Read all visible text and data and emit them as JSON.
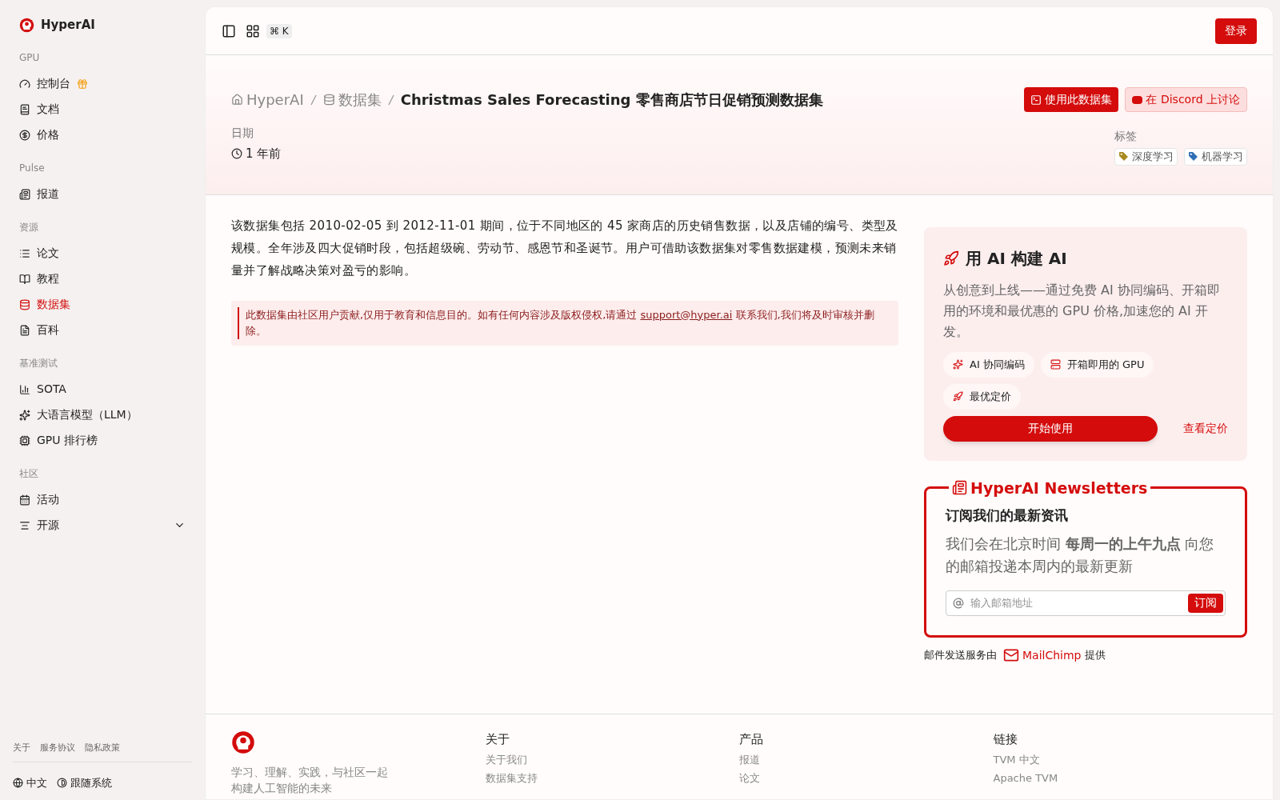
{
  "brand": "HyperAI",
  "sidebar": {
    "groups": [
      {
        "label": "GPU",
        "items": [
          {
            "label": "控制台",
            "selected": false
          },
          {
            "label": "文档",
            "selected": false
          },
          {
            "label": "价格",
            "selected": false
          }
        ]
      },
      {
        "label": "Pulse",
        "items": [
          {
            "label": "报道",
            "selected": false
          }
        ]
      },
      {
        "label": "资源",
        "items": [
          {
            "label": "论文",
            "selected": false
          },
          {
            "label": "教程",
            "selected": false
          },
          {
            "label": "数据集",
            "selected": true
          },
          {
            "label": "百科",
            "selected": false
          }
        ]
      },
      {
        "label": "基准测试",
        "items": [
          {
            "label": "SOTA",
            "selected": false
          },
          {
            "label": "大语言模型（LLM）",
            "selected": false
          },
          {
            "label": "GPU 排行榜",
            "selected": false
          }
        ]
      },
      {
        "label": "社区",
        "items": [
          {
            "label": "活动",
            "selected": false
          },
          {
            "label": "开源",
            "selected": false,
            "expanded": false
          }
        ]
      }
    ],
    "footer_links": [
      "关于",
      "服务协议",
      "隐私政策"
    ],
    "language": "中文",
    "theme": "跟随系统"
  },
  "topbar": {
    "shortcut": "⌘ K",
    "login": "登录"
  },
  "breadcrumb": [
    "HyperAI",
    "数据集"
  ],
  "title": "Christmas Sales Forecasting 零售商店节日促销预测数据集",
  "actions": [
    "使用此数据集",
    "在 Discord 上讨论"
  ],
  "date_label": "日期",
  "date": "1 年前",
  "tags_label": "标签",
  "tags": [
    {
      "label": "深度学习",
      "color": "#a8891f"
    },
    {
      "label": "机器学习",
      "color": "#2f6fb5"
    }
  ],
  "description": "该数据集包括 2010-02-05 到 2012-11-01 期间，位于不同地区的 45 家商店的历史销售数据，以及店铺的编号、类型及规模。全年涉及四大促销时段，包括超级碗、劳动节、感恩节和圣诞节。用户可借助该数据集对零售数据建模，预测未来销量并了解战略决策对盈亏的影响。",
  "notice": {
    "before": "此数据集由社区用户贡献,仅用于教育和信息目的。如有任何内容涉及版权侵权,请通过",
    "link": "support@hyper.ai",
    "after": "联系我们,我们将及时审核并删除。"
  },
  "promo": {
    "title": "用 AI 构建 AI",
    "text": "从创意到上线——通过免费 AI 协同编码、开箱即用的环境和最优惠的 GPU 价格,加速您的 AI 开发。",
    "features": [
      {
        "label": "AI 协同编码"
      },
      {
        "label": "开箱即用的 GPU"
      },
      {
        "label": "最优定价"
      }
    ],
    "start": "开始使用",
    "pricing": "查看定价"
  },
  "newsletter": {
    "title": "HyperAI Newsletters",
    "heading": "订阅我们的最新资讯",
    "text": "我们会在北京时间 **每周一的上午九点** 向您的邮箱投递本周内的最新更新",
    "placeholder": "输入邮箱地址",
    "button": "订阅",
    "credit_before": "邮件发送服务由",
    "credit_brand": "MailChimp",
    "credit_after": "提供"
  },
  "footer": {
    "slogan": "学习、理解、实践，与社区一起构建人工智能的未来",
    "columns": [
      {
        "title": "关于",
        "links": [
          "关于我们",
          "数据集支持"
        ]
      },
      {
        "title": "产品",
        "links": [
          "报道",
          "论文"
        ]
      },
      {
        "title": "链接",
        "links": [
          "TVM 中文",
          "Apache TVM"
        ]
      }
    ]
  }
}
